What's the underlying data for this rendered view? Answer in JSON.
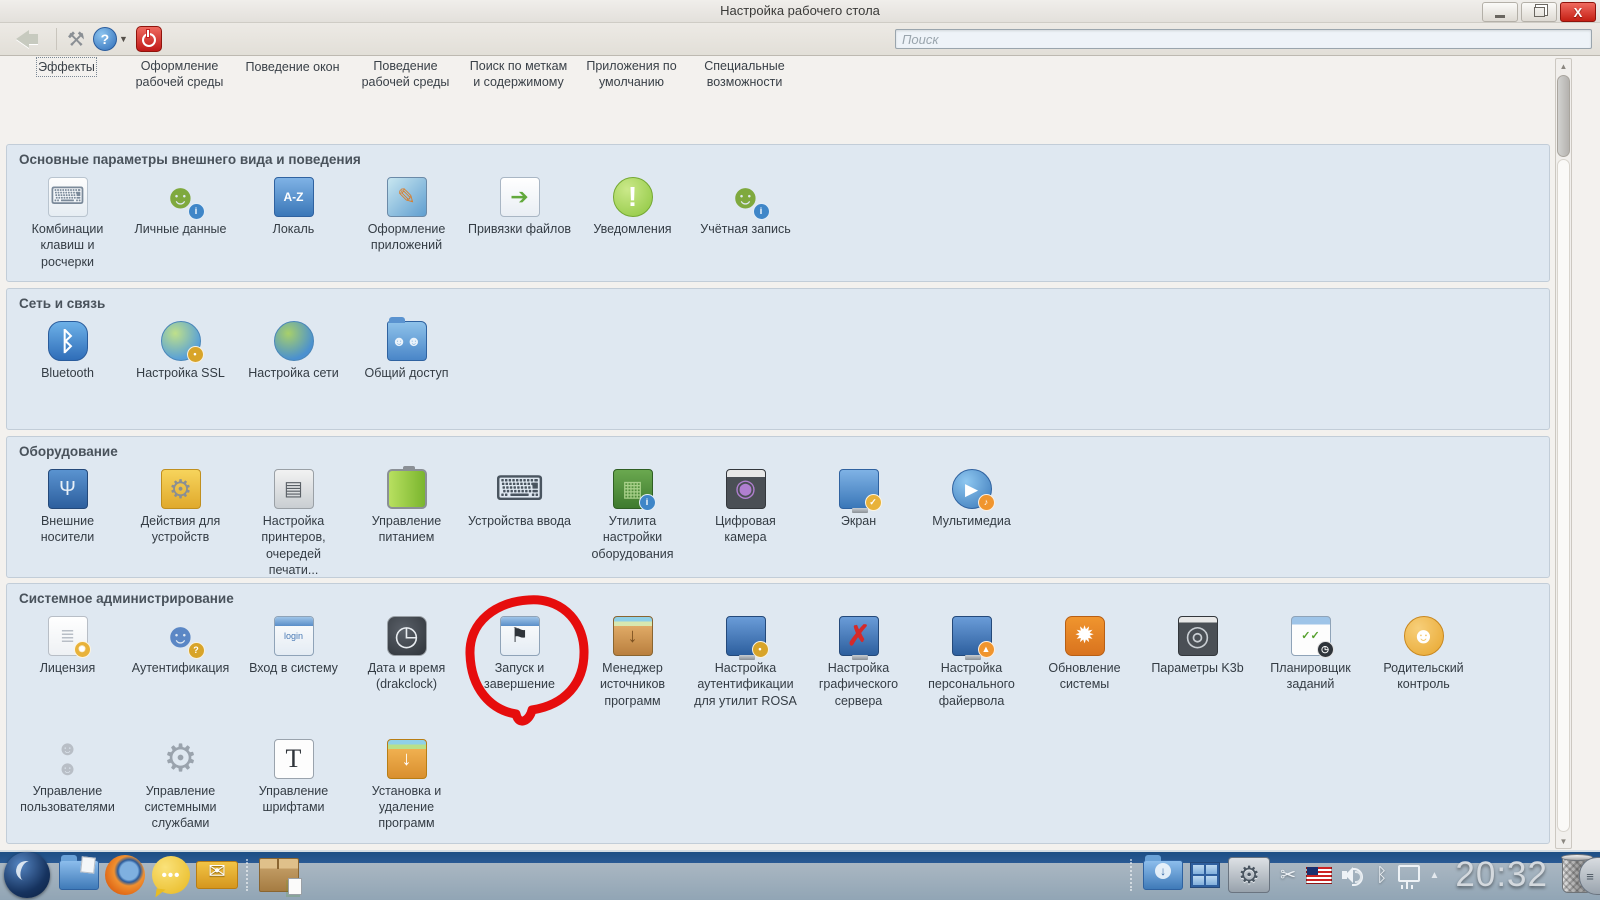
{
  "window": {
    "title": "Настройка рабочего стола"
  },
  "toolbar": {
    "search_placeholder": "Поиск"
  },
  "annotation": {
    "color": "#e60d0d",
    "target": "Запуск и завершение"
  },
  "top_row": {
    "items": [
      {
        "label": "Эффекты",
        "focused": true
      },
      {
        "label": "Оформление рабочей среды"
      },
      {
        "label": "Поведение окон"
      },
      {
        "label": "Поведение рабочей среды"
      },
      {
        "label": "Поиск по меткам и содержимому"
      },
      {
        "label": "Приложения по умолчанию"
      },
      {
        "label": "Специальные возможности"
      }
    ]
  },
  "sections": [
    {
      "title": "Основные параметры внешнего вида и поведения",
      "items": [
        {
          "label": "Комбинации клавиш и росчерки",
          "icon": "shortcut-keys-icon"
        },
        {
          "label": "Личные данные",
          "icon": "personal-data-icon"
        },
        {
          "label": "Локаль",
          "icon": "locale-icon"
        },
        {
          "label": "Оформление приложений",
          "icon": "app-appearance-icon"
        },
        {
          "label": "Привязки файлов",
          "icon": "file-associations-icon"
        },
        {
          "label": "Уведомления",
          "icon": "notifications-icon"
        },
        {
          "label": "Учётная запись",
          "icon": "account-icon"
        }
      ]
    },
    {
      "title": "Сеть и связь",
      "items": [
        {
          "label": "Bluetooth",
          "icon": "bluetooth-icon"
        },
        {
          "label": "Настройка SSL",
          "icon": "ssl-config-icon"
        },
        {
          "label": "Настройка сети",
          "icon": "network-config-icon"
        },
        {
          "label": "Общий доступ",
          "icon": "shared-access-icon"
        }
      ]
    },
    {
      "title": "Оборудование",
      "items": [
        {
          "label": "Внешние носители",
          "icon": "removable-media-icon"
        },
        {
          "label": "Действия для устройств",
          "icon": "device-actions-icon"
        },
        {
          "label": "Настройка принтеров, очередей печати...",
          "icon": "printer-icon"
        },
        {
          "label": "Управление питанием",
          "icon": "power-management-icon"
        },
        {
          "label": "Устройства ввода",
          "icon": "input-devices-icon"
        },
        {
          "label": "Утилита настройки оборудования",
          "icon": "hardware-config-icon"
        },
        {
          "label": "Цифровая камера",
          "icon": "camera-icon"
        },
        {
          "label": "Экран",
          "icon": "screen-icon"
        },
        {
          "label": "Мультимедиа",
          "icon": "multimedia-icon"
        }
      ]
    },
    {
      "title": "Системное администрирование",
      "items": [
        {
          "label": "Лицензия",
          "icon": "license-icon"
        },
        {
          "label": "Аутентификация",
          "icon": "authentication-icon"
        },
        {
          "label": "Вход в систему",
          "icon": "login-icon"
        },
        {
          "label": "Дата и время (drakclock)",
          "icon": "datetime-icon"
        },
        {
          "label": "Запуск и завершение",
          "icon": "startup-shutdown-icon"
        },
        {
          "label": "Менеджер источников программ",
          "icon": "software-sources-icon"
        },
        {
          "label": "Настройка аутентификации для утилит ROSA",
          "icon": "rosa-auth-icon"
        },
        {
          "label": "Настройка графического сервера",
          "icon": "xserver-config-icon"
        },
        {
          "label": "Настройка персонального файервола",
          "icon": "firewall-icon"
        },
        {
          "label": "Обновление системы",
          "icon": "system-update-icon"
        },
        {
          "label": "Параметры K3b",
          "icon": "k3b-settings-icon"
        },
        {
          "label": "Планировщик заданий",
          "icon": "task-scheduler-icon"
        },
        {
          "label": "Родительский контроль",
          "icon": "parental-control-icon"
        }
      ],
      "items_row2": [
        {
          "label": "Управление пользователями",
          "icon": "user-management-icon"
        },
        {
          "label": "Управление системными службами",
          "icon": "system-services-icon"
        },
        {
          "label": "Управление шрифтами",
          "icon": "font-management-icon"
        },
        {
          "label": "Установка и удаление программ",
          "icon": "install-remove-icon"
        }
      ]
    }
  ],
  "taskbar": {
    "clock": "20:32"
  }
}
